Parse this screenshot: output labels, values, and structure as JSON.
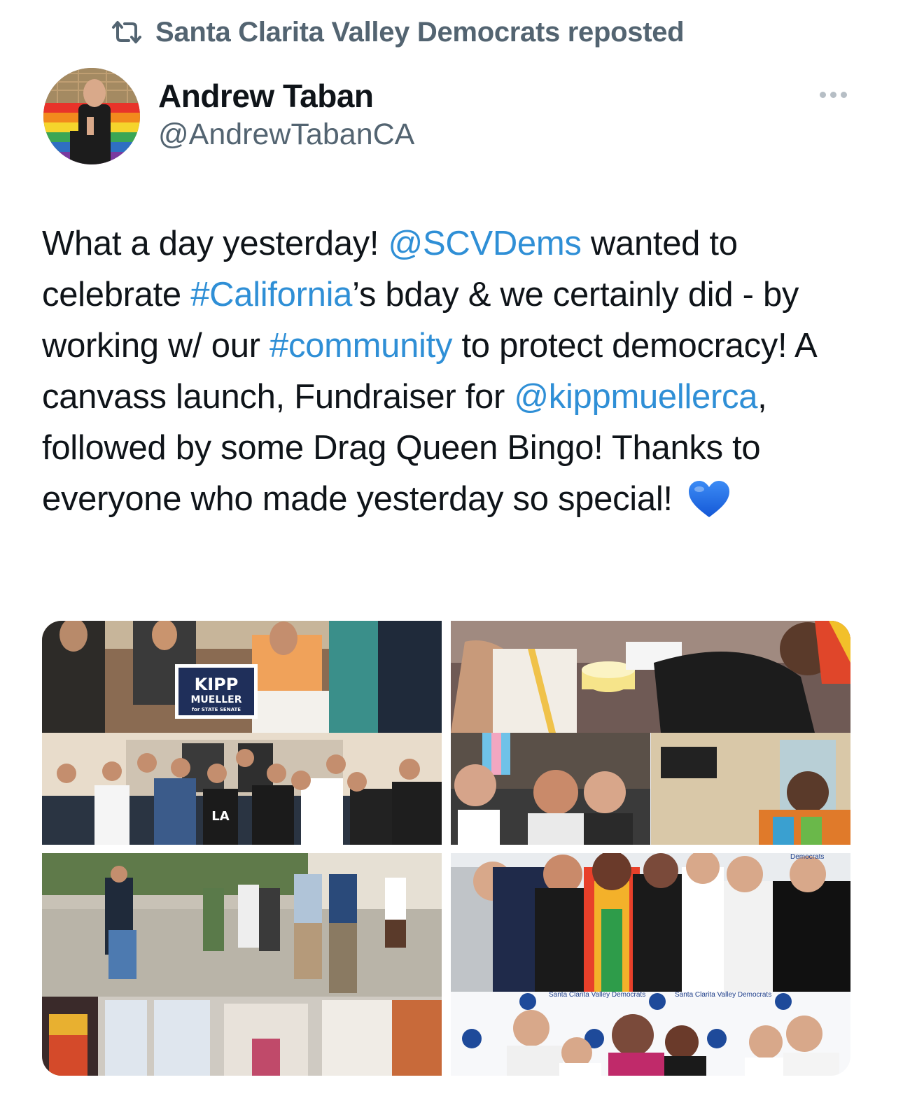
{
  "repost": {
    "icon": "repost-icon",
    "text": "Santa Clarita Valley Democrats reposted"
  },
  "author": {
    "display_name": "Andrew Taban",
    "handle": "@AndrewTabanCA",
    "avatar_icon": "avatar"
  },
  "more_icon": "more-options-icon",
  "tweet": {
    "segments": [
      {
        "text": "What a day yesterday! ",
        "type": "text"
      },
      {
        "text": "@SCVDems",
        "type": "mention"
      },
      {
        "text": " wanted to celebrate ",
        "type": "text"
      },
      {
        "text": "#California",
        "type": "hashtag"
      },
      {
        "text": "’s bday & we certainly did - by working w/ our ",
        "type": "text"
      },
      {
        "text": "#community",
        "type": "hashtag"
      },
      {
        "text": " to protect democracy! A canvass launch, Fundraiser for ",
        "type": "text"
      },
      {
        "text": "@kippmuellerca",
        "type": "mention"
      },
      {
        "text": ", followed by some Drag Queen Bingo! Thanks to everyone who made yesterday so special! ",
        "type": "text"
      }
    ],
    "emoji": "blue-heart-icon"
  },
  "media": {
    "sign_line1": "KIPP",
    "sign_line2": "MUELLER",
    "sign_line3": "for STATE SENATE",
    "backdrop_text": "Santa Clarita Valley Democrats",
    "backdrop_short": "Democrats",
    "shirt_text": "LA",
    "colors": {
      "link": "#2f8fd6",
      "secondary": "#536471",
      "heart": "#1d6ff0"
    }
  }
}
